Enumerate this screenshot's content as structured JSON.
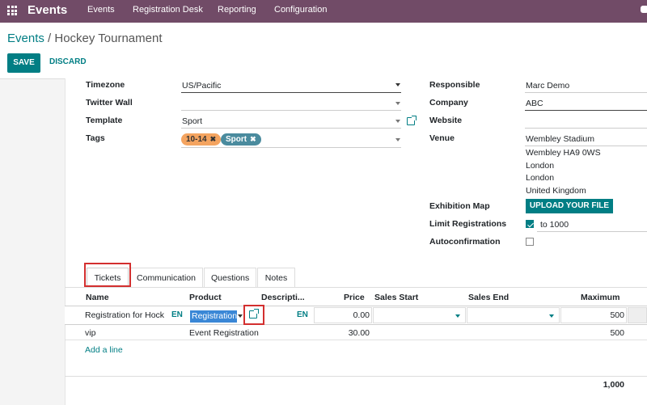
{
  "navbar": {
    "brand": "Events",
    "menu": [
      "Events",
      "Registration Desk",
      "Reporting",
      "Configuration"
    ]
  },
  "breadcrumb": {
    "parent": "Events",
    "separator": " / ",
    "current": "Hockey Tournament"
  },
  "buttons": {
    "save": "SAVE",
    "discard": "DISCARD"
  },
  "form": {
    "left": {
      "timezone_label": "Timezone",
      "timezone_value": "US/Pacific",
      "twitter_label": "Twitter Wall",
      "twitter_value": "",
      "template_label": "Template",
      "template_value": "Sport",
      "tags_label": "Tags",
      "tags": [
        "10-14",
        "Sport"
      ]
    },
    "right": {
      "responsible_label": "Responsible",
      "responsible_value": "Marc Demo",
      "company_label": "Company",
      "company_value": "ABC",
      "website_label": "Website",
      "website_value": "",
      "venue_label": "Venue",
      "venue_lines": [
        "Wembley Stadium",
        "Wembley HA9 0WS",
        "London",
        "London",
        "United Kingdom"
      ],
      "exhibition_label": "Exhibition Map",
      "upload_button": "UPLOAD YOUR FILE",
      "limit_label": "Limit Registrations",
      "limit_checked": true,
      "limit_value": "to 1000",
      "autoconfirm_label": "Autoconfirmation",
      "autoconfirm_checked": false
    }
  },
  "tabs": [
    "Tickets",
    "Communication",
    "Questions",
    "Notes"
  ],
  "table": {
    "headers": [
      "Name",
      "Product",
      "Descripti...",
      "Price",
      "Sales Start",
      "Sales End",
      "Maximum"
    ],
    "edit_row": {
      "name": "Registration for Hock",
      "name_lang": "EN",
      "product": "Registration",
      "desc_lang": "EN",
      "price": "0.00",
      "sales_start": "",
      "sales_end": "",
      "maximum": "500"
    },
    "rows": [
      {
        "name": "vip",
        "product": "Event Registration",
        "price": "30.00",
        "maximum": "500"
      }
    ],
    "add_line": "Add a line",
    "total": "1,000"
  },
  "colors": {
    "brand": "#714B67",
    "accent": "#017E84",
    "highlight": "#D32F2F"
  }
}
